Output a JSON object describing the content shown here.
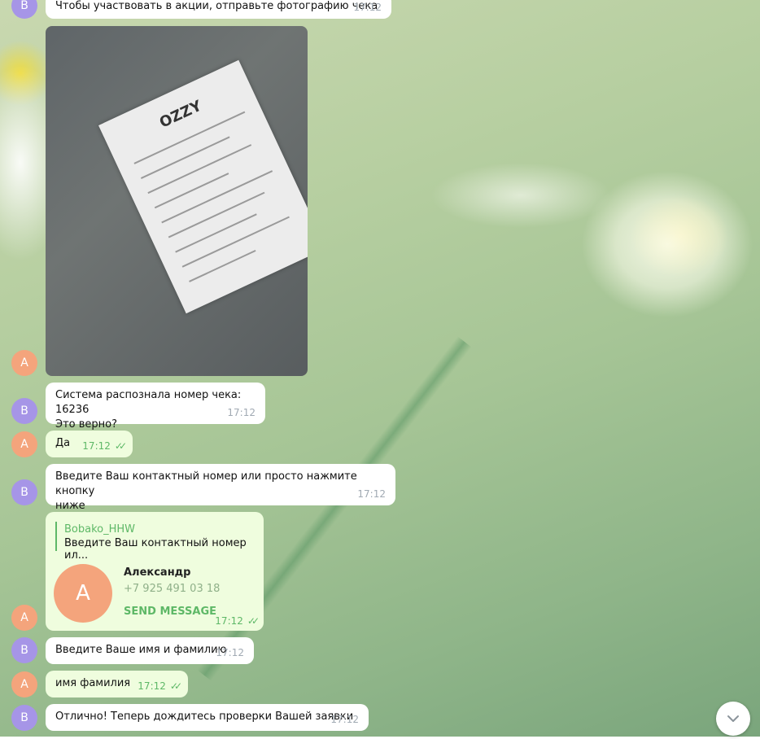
{
  "messages": {
    "m1": {
      "avatar": "B",
      "text": "Чтобы участвовать в акции, отправьте фотографию чека",
      "time": "17:12"
    },
    "photo_avatar": "A",
    "photo": {
      "receipt_logo": "OZZY"
    },
    "m3": {
      "avatar": "B",
      "line1": "Система распознала номер чека: 16236",
      "line2": "Это верно?",
      "time": "17:12"
    },
    "m4": {
      "avatar": "A",
      "text": "Да",
      "time": "17:12"
    },
    "m5": {
      "avatar": "B",
      "line1": "Введите Ваш контактный номер или просто нажмите кнопку",
      "line2": "ниже",
      "time": "17:12"
    },
    "m6": {
      "avatar": "A",
      "reply_name": "Bobako_HHW",
      "reply_text": "Введите Ваш контактный номер ил...",
      "contact_initial": "А",
      "contact_name": "Александр",
      "contact_phone": "+7 925 491 03 18",
      "send_label": "SEND MESSAGE",
      "time": "17:12"
    },
    "m7": {
      "avatar": "B",
      "text": "Введите Ваше имя и фамилию",
      "time": "17:12"
    },
    "m8": {
      "avatar": "A",
      "text": "имя фамилия",
      "time": "17:12"
    },
    "m9": {
      "avatar": "B",
      "text": "Отлично! Теперь дождитесь проверки Вашей заявки",
      "time": "17:12"
    }
  },
  "colors": {
    "bot_avatar": "#a695e7",
    "user_avatar": "#f4a47c",
    "accent": "#5eb867",
    "outgoing_bubble": "#effdde"
  },
  "icons": {
    "ticks": "double-check-icon",
    "scroll": "chevron-down-icon"
  }
}
